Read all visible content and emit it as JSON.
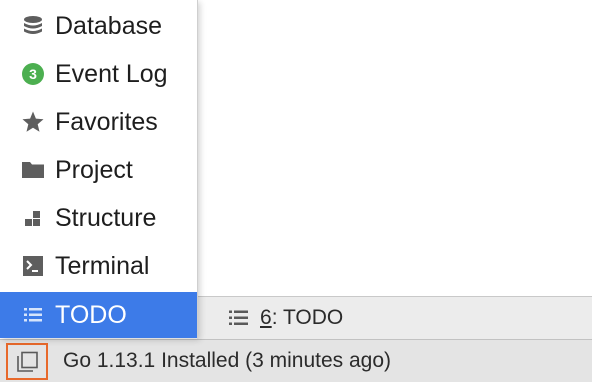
{
  "popup": {
    "items": [
      {
        "label": "Database",
        "icon": "database-icon"
      },
      {
        "label": "Event Log",
        "icon": "event-log-badge-icon",
        "badge": "3"
      },
      {
        "label": "Favorites",
        "icon": "star-icon"
      },
      {
        "label": "Project",
        "icon": "folder-icon"
      },
      {
        "label": "Structure",
        "icon": "structure-icon"
      },
      {
        "label": "Terminal",
        "icon": "terminal-icon"
      },
      {
        "label": "TODO",
        "icon": "list-icon",
        "selected": true
      }
    ]
  },
  "tool_strip": {
    "todo_tab": {
      "number": "6",
      "label": ": TODO"
    }
  },
  "status_bar": {
    "message": "Go 1.13.1 Installed (3 minutes ago)"
  },
  "colors": {
    "selection": "#3d7be8",
    "badge_green": "#4caf50",
    "highlight_border": "#e8692b"
  }
}
